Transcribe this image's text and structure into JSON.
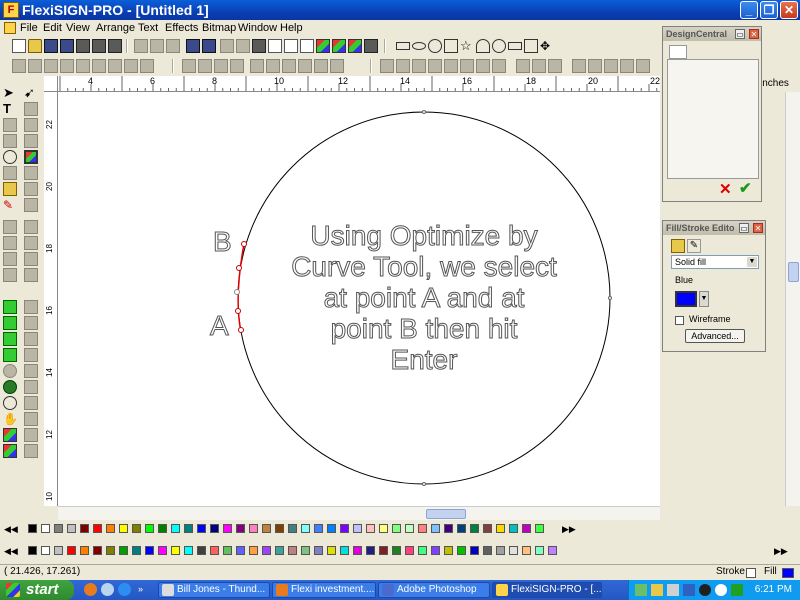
{
  "window": {
    "title": "FlexiSIGN-PRO - [Untitled 1]",
    "buttons": {
      "minimize": "_",
      "maximize": "❐",
      "close": "✕"
    }
  },
  "menu": [
    "File",
    "Edit",
    "View",
    "Arrange",
    "Text",
    "Effects",
    "Bitmap",
    "Window",
    "Help"
  ],
  "ruler": {
    "units": "inches",
    "h_labels": [
      "4",
      "6",
      "8",
      "10",
      "12",
      "14",
      "16",
      "18",
      "20",
      "22"
    ],
    "v_labels": [
      "22",
      "20",
      "18",
      "16",
      "14",
      "12",
      "10"
    ]
  },
  "canvas": {
    "instruction_lines": [
      "Using Optimize by",
      "Curve Tool, we select",
      "at point A and at",
      "point B then hit",
      "Enter"
    ],
    "label_a": "A",
    "label_b": "B"
  },
  "design_central": {
    "title": "DesignCentral"
  },
  "fill_stroke": {
    "title": "Fill/Stroke Edito",
    "fill_type": "Solid fill",
    "color_name": "Blue",
    "color": "#0000ff",
    "wireframe_label": "Wireframe",
    "advanced_label": "Advanced..."
  },
  "palette_colors_1": [
    "#000000",
    "#ffffff",
    "#808080",
    "#c0c0c0",
    "#800000",
    "#ff0000",
    "#ff8000",
    "#ffff00",
    "#808000",
    "#00ff00",
    "#008000",
    "#00ffff",
    "#008080",
    "#0000ff",
    "#000080",
    "#ff00ff",
    "#800080",
    "#ff80c0",
    "#c08040",
    "#804000",
    "#408080",
    "#80ffff",
    "#4080ff",
    "#0080ff",
    "#8000ff",
    "#c0c0ff",
    "#ffc0c0",
    "#ffff80",
    "#80ff80",
    "#c0ffc0",
    "#ff8080",
    "#80c0ff",
    "#400080",
    "#004080",
    "#008040",
    "#804040",
    "#ffd700",
    "#00c0c0",
    "#c000c0",
    "#40ff40"
  ],
  "palette_colors_2": [
    "#000000",
    "#ffffff",
    "#c0c0c0",
    "#ff0000",
    "#ff8000",
    "#800000",
    "#808000",
    "#00a000",
    "#008080",
    "#0000ff",
    "#ff00ff",
    "#ffff00",
    "#00ffff",
    "#404040",
    "#ff6060",
    "#60c060",
    "#6060ff",
    "#ffa040",
    "#a040ff",
    "#40a0a0",
    "#c08080",
    "#80c080",
    "#8080c0",
    "#e0e000",
    "#00e0e0",
    "#e000e0",
    "#202080",
    "#802020",
    "#208020",
    "#ff4080",
    "#40ff80",
    "#8040ff",
    "#c0c000",
    "#00c000",
    "#0000c0",
    "#606060",
    "#a0a0a0",
    "#e0e0e0",
    "#ffc080",
    "#80ffc0",
    "#c080ff"
  ],
  "status": {
    "coordinates": "(    21.426,    17.261)",
    "stroke_label": "Stroke",
    "fill_label": "Fill",
    "fill_color": "#0000ff"
  },
  "taskbar": {
    "start_label": "start",
    "tasks": [
      "Bill Jones - Thund...",
      "Flexi investment....",
      "Adobe Photoshop",
      "FlexiSIGN-PRO - [..."
    ],
    "clock": "6:21 PM"
  }
}
